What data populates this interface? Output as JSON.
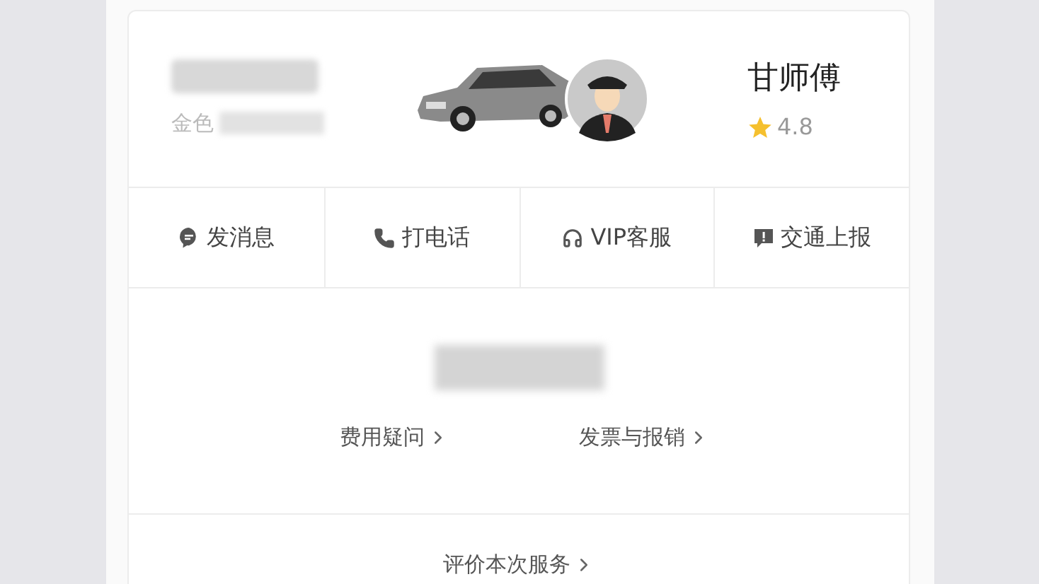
{
  "driver": {
    "car_color": "金色",
    "name": "甘师傅",
    "rating": "4.8"
  },
  "actions": [
    {
      "label": "发消息"
    },
    {
      "label": "打电话"
    },
    {
      "label": "VIP客服"
    },
    {
      "label": "交通上报"
    }
  ],
  "fare_links": [
    {
      "label": "费用疑问"
    },
    {
      "label": "发票与报销"
    }
  ],
  "review_link": {
    "label": "评价本次服务"
  }
}
